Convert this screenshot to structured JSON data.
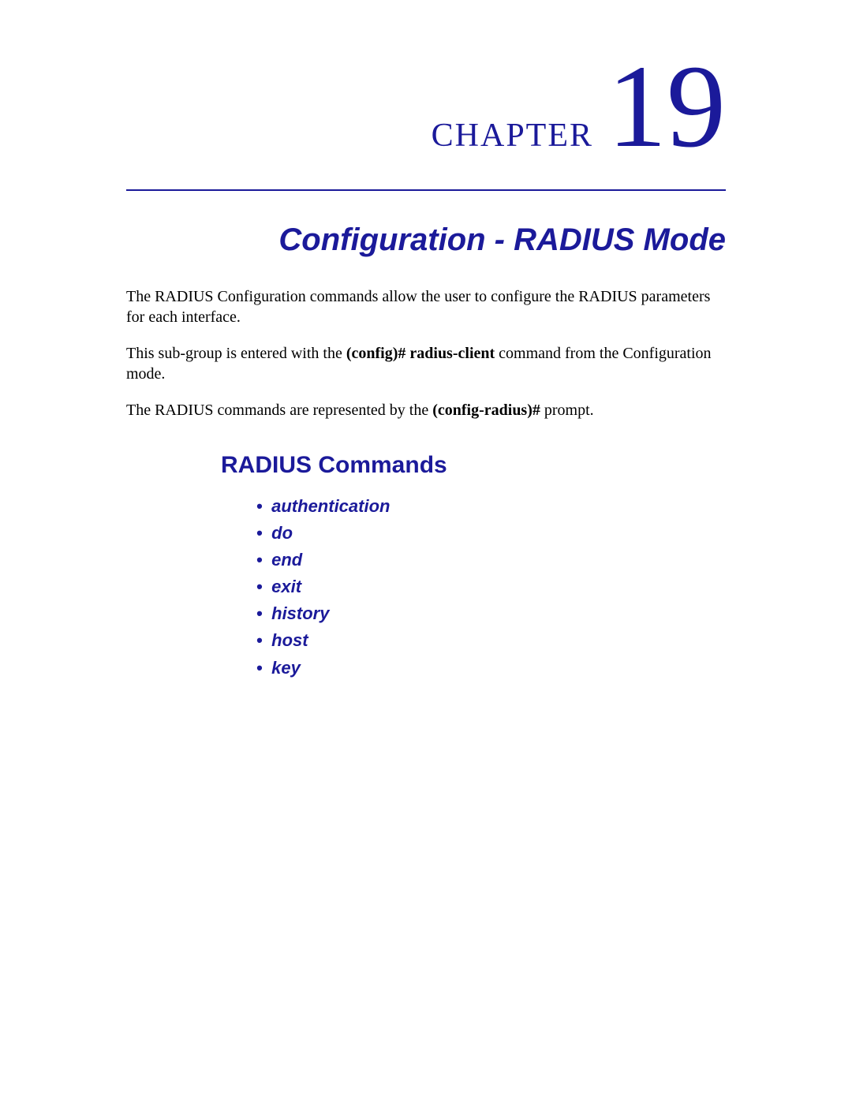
{
  "chapter": {
    "label": "CHAPTER",
    "number": "19",
    "title": "Configuration - RADIUS Mode"
  },
  "paragraphs": {
    "p1": "The RADIUS Configuration commands allow the user to configure the RADIUS parameters for each interface.",
    "p2_pre": "This sub-group is entered with the ",
    "p2_bold": "(config)# radius-client",
    "p2_post": " command from the Configuration mode.",
    "p3_pre": "The RADIUS commands are represented by the ",
    "p3_bold": "(config-radius)#",
    "p3_post": " prompt."
  },
  "section": {
    "heading": "RADIUS Commands",
    "commands": [
      "authentication",
      "do",
      "end",
      "exit",
      "history",
      "host",
      "key"
    ]
  },
  "bullet_glyph": "•"
}
